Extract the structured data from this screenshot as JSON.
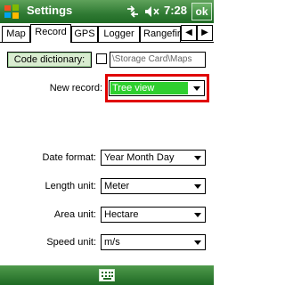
{
  "titlebar": {
    "title": "Settings",
    "time": "7:28",
    "ok_label": "ok",
    "icons": [
      "windows-start-icon",
      "connectivity-icon",
      "volume-icon"
    ]
  },
  "tabs": {
    "items": [
      {
        "label": "Map",
        "active": false
      },
      {
        "label": "Record",
        "active": true
      },
      {
        "label": "GPS",
        "active": false
      },
      {
        "label": "Logger",
        "active": false
      },
      {
        "label": "Rangefir",
        "active": false
      }
    ],
    "scroll_left": "◀",
    "scroll_right": "▶"
  },
  "form": {
    "code_dictionary_label": "Code dictionary:",
    "code_dictionary_checked": false,
    "code_dictionary_path": "\\Storage Card\\Maps",
    "new_record": {
      "label": "New record:",
      "value": "Tree view",
      "highlighted": true,
      "highlight_color": "#e00000",
      "selected_bg": "#2fcf2f"
    },
    "date_format": {
      "label": "Date format:",
      "value": "Year Month Day"
    },
    "length_unit": {
      "label": "Length unit:",
      "value": "Meter"
    },
    "area_unit": {
      "label": "Area unit:",
      "value": "Hectare"
    },
    "speed_unit": {
      "label": "Speed unit:",
      "value": "m/s"
    }
  },
  "bottombar": {
    "keyboard_icon": "keyboard-icon"
  }
}
